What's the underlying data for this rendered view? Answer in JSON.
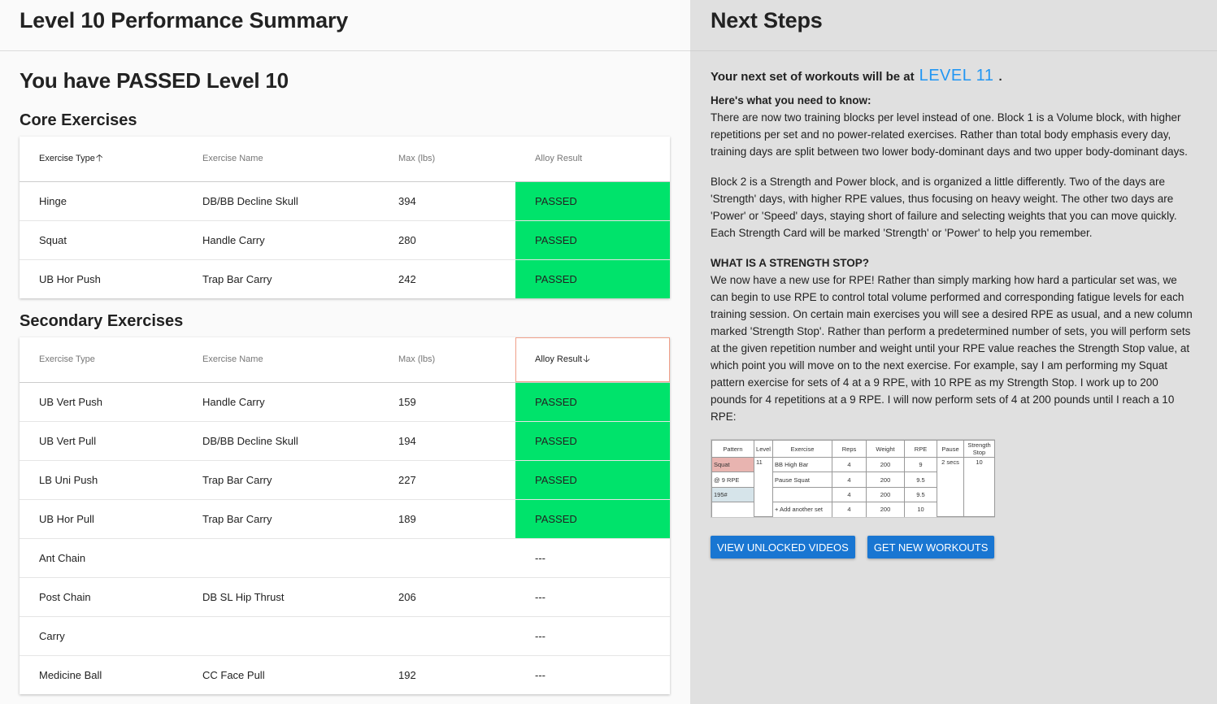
{
  "left": {
    "header_title": "Level 10 Performance Summary",
    "passed_title": "You have PASSED Level 10",
    "core": {
      "title": "Core Exercises",
      "headers": [
        "Exercise Type",
        "Exercise Name",
        "Max (lbs)",
        "Alloy Result"
      ],
      "rows": [
        [
          "Hinge",
          "DB/BB Decline Skull",
          "394",
          "PASSED"
        ],
        [
          "Squat",
          "Handle Carry",
          "280",
          "PASSED"
        ],
        [
          "UB Hor Push",
          "Trap Bar Carry",
          "242",
          "PASSED"
        ]
      ]
    },
    "secondary": {
      "title": "Secondary Exercises",
      "headers": [
        "Exercise Type",
        "Exercise Name",
        "Max (lbs)",
        "Alloy Result"
      ],
      "rows": [
        [
          "UB Vert Push",
          "Handle Carry",
          "159",
          "PASSED"
        ],
        [
          "UB Vert Pull",
          "DB/BB Decline Skull",
          "194",
          "PASSED"
        ],
        [
          "LB Uni Push",
          "Trap Bar Carry",
          "227",
          "PASSED"
        ],
        [
          "UB Hor Pull",
          "Trap Bar Carry",
          "189",
          "PASSED"
        ],
        [
          "Ant Chain",
          "",
          "",
          "---"
        ],
        [
          "Post Chain",
          "DB SL Hip Thrust",
          "206",
          "---"
        ],
        [
          "Carry",
          "",
          "",
          "---"
        ],
        [
          "Medicine Ball",
          "CC Face Pull",
          "192",
          "---"
        ]
      ]
    },
    "sort_up_icon": "arrow-up-icon",
    "sort_down_icon": "arrow-down-icon"
  },
  "right": {
    "header_title": "Next Steps",
    "next_prefix": "Your next set of workouts will be at",
    "next_level": "LEVEL 11",
    "next_suffix": ".",
    "need_label": "Here's what you need to know:",
    "p1": "There are now two training blocks per level instead of one. Block 1 is a Volume block, with higher repetitions per set and no power-related exercises. Rather than total body emphasis every day, training days are split between two lower body-dominant days and two upper body-dominant days.",
    "p2": "Block 2 is a Strength and Power block, and is organized a little differently. Two of the days are 'Strength' days, with higher RPE values, thus focusing on heavy weight. The other two days are 'Power' or 'Speed' days, staying short of failure and selecting weights that you can move quickly. Each Strength Card will be marked 'Strength' or 'Power' to help you remember.",
    "stop_label": "WHAT IS A STRENGTH STOP?",
    "p3": "We now have a new use for RPE! Rather than simply marking how hard a particular set was, we can begin to use RPE to control total volume performed and corresponding fatigue levels for each training session. On certain main exercises you will see a desired RPE as usual, and a new column marked 'Strength Stop'. Rather than perform a predetermined number of sets, you will perform sets at the given repetition number and weight until your RPE value reaches the Strength Stop value, at which point you will move on to the next exercise. For example, say I am performing my Squat pattern exercise for sets of 4 at a 9 RPE, with 10 RPE as my Strength Stop. I work up to 200 pounds for 4 repetitions at a 9 RPE. I will now perform sets of 4 at 200 pounds until I reach a 10 RPE:",
    "example": {
      "headers": [
        "Pattern",
        "Level",
        "Exercise",
        "Reps",
        "Weight",
        "RPE",
        "Pause",
        "Strength Stop"
      ],
      "pattern": [
        "Squat",
        "@ 9 RPE",
        "195#",
        ""
      ],
      "level": "11",
      "exercise": [
        "BB High Bar",
        "Pause Squat",
        "",
        "+ Add another set"
      ],
      "reps": [
        "4",
        "4",
        "4",
        "4"
      ],
      "weight": [
        "200",
        "200",
        "200",
        "200"
      ],
      "rpe": [
        "9",
        "9.5",
        "9.5",
        "10"
      ],
      "pause": "2 secs",
      "stop": "10"
    },
    "buttons": {
      "videos": "VIEW UNLOCKED VIDEOS",
      "workouts": "GET NEW WORKOUTS"
    }
  },
  "colors": {
    "passed": "#00e36b",
    "accent": "#2196f3",
    "button": "#1976d2"
  }
}
